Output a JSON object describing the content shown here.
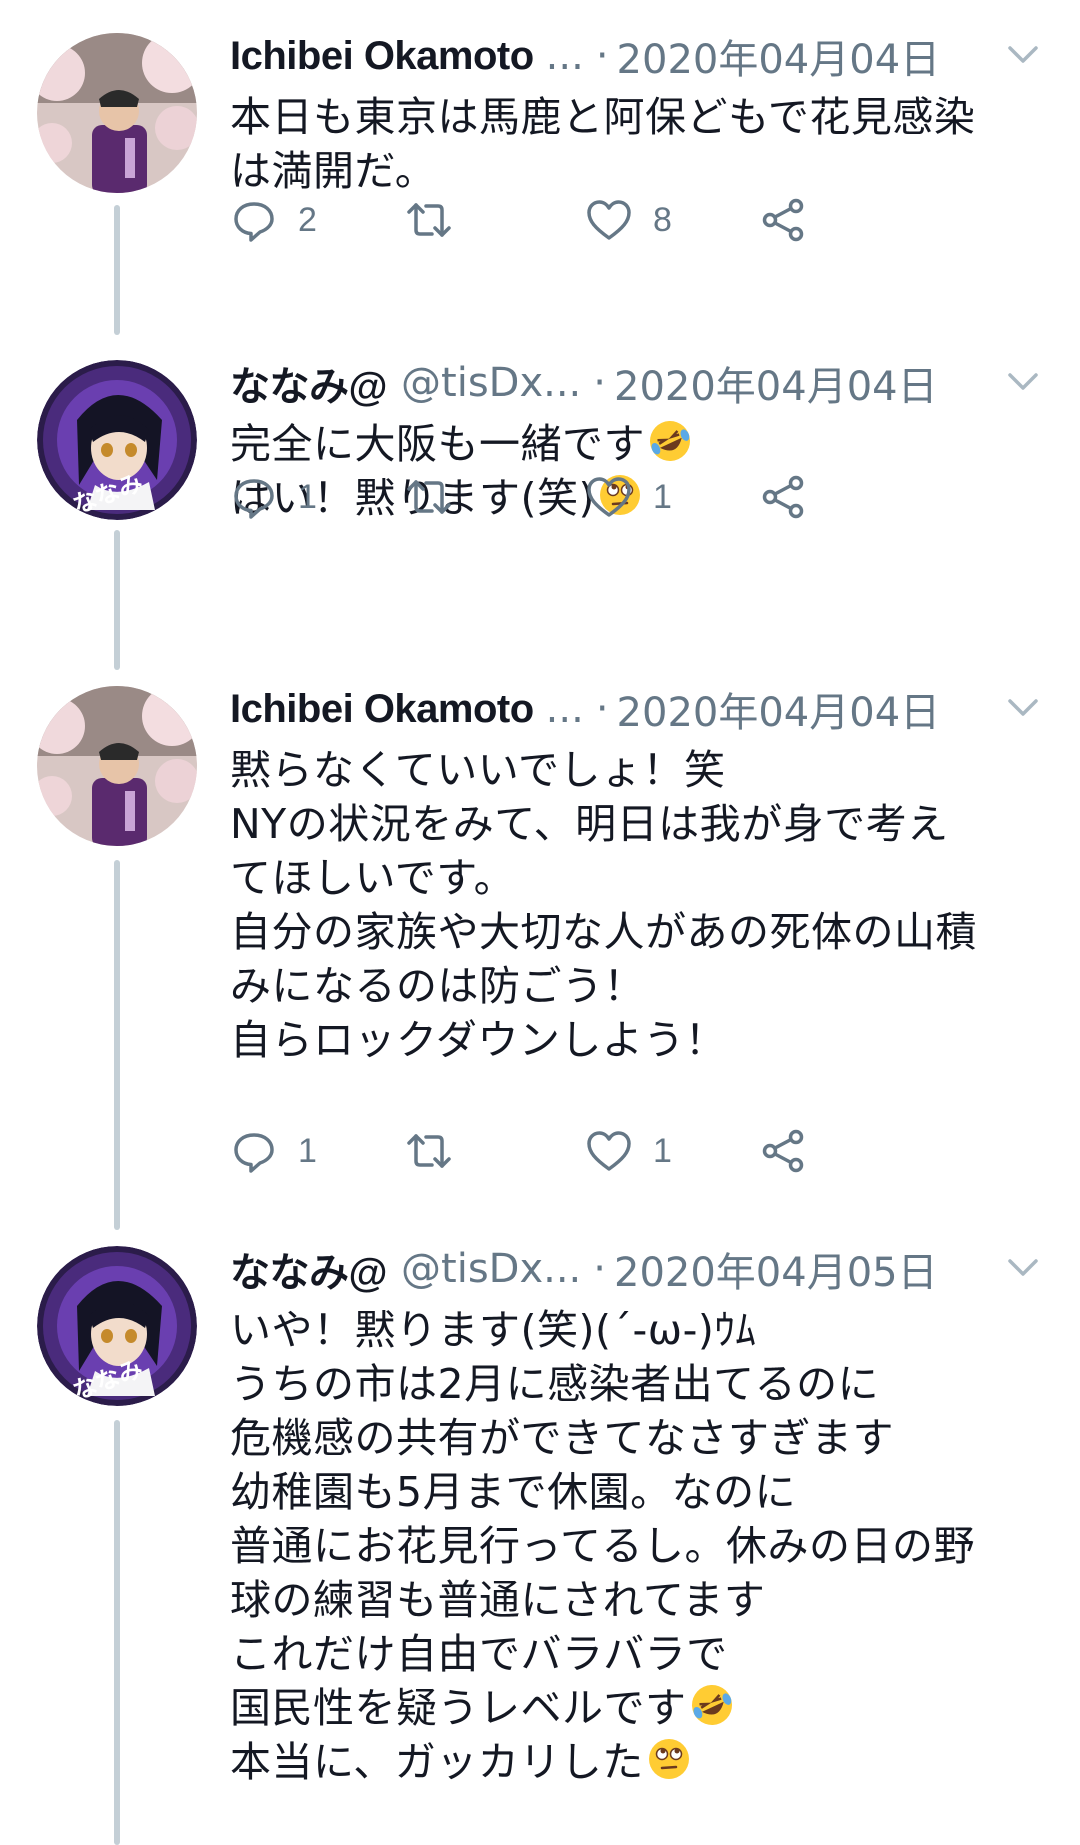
{
  "tweets": [
    {
      "name": "Ichibei Okamoto",
      "handle": "",
      "ellipsis": "...",
      "separator": "·",
      "date": "2020年04月04日",
      "avatar": "avatar-ichibei",
      "body": "本日も東京は馬鹿と阿保どもで花見感染\nは満開だ。",
      "replies": "2",
      "retweets": "",
      "likes": "8"
    },
    {
      "name": "ななみ@",
      "handle": "@tisDx...",
      "ellipsis": "",
      "separator": "·",
      "date": "2020年04月04日",
      "avatar": "avatar-nanami",
      "avatar_label": "ななみ",
      "body_lines": [
        {
          "text": "完全に大阪も一緒です",
          "emoji": "rofl"
        },
        {
          "text": "はい！黙ります(笑)",
          "emoji": "rolling-eyes"
        }
      ],
      "replies": "1",
      "retweets": "",
      "likes": "1"
    },
    {
      "name": "Ichibei Okamoto",
      "handle": "",
      "ellipsis": "...",
      "separator": "·",
      "date": "2020年04月04日",
      "avatar": "avatar-ichibei",
      "body": "黙らなくていいでしょ！笑\nNYの状況をみて、明日は我が身で考え\nてほしいです。\n自分の家族や大切な人があの死体の山積\nみになるのは防ごう！\n自らロックダウンしよう！",
      "replies": "1",
      "retweets": "",
      "likes": "1"
    },
    {
      "name": "ななみ@",
      "handle": "@tisDx...",
      "ellipsis": "",
      "separator": "·",
      "date": "2020年04月05日",
      "avatar": "avatar-nanami",
      "avatar_label": "ななみ",
      "body_lines": [
        {
          "text": "いや！黙ります(笑)(´-ω-)ｳﾑ"
        },
        {
          "text": "うちの市は2月に感染者出てるのに"
        },
        {
          "text": "危機感の共有ができてなさすぎます"
        },
        {
          "text": "幼稚園も5月まで休園。なのに"
        },
        {
          "text": "普通にお花見行ってるし。休みの日の野"
        },
        {
          "text": "球の練習も普通にされてます"
        },
        {
          "text": "これだけ自由でバラバラで"
        },
        {
          "text": "国民性を疑うレベルです",
          "emoji": "rofl"
        },
        {
          "text": "本当に、ガッカリした",
          "emoji": "rolling-eyes"
        }
      ]
    }
  ],
  "icons": {
    "reply": "reply-icon",
    "retweet": "retweet-icon",
    "like": "heart-icon",
    "share": "share-icon",
    "menu": "chevron-down-icon"
  },
  "colors": {
    "text": "#141823",
    "secondary": "#657786",
    "thread_line": "#c4cfd6"
  }
}
